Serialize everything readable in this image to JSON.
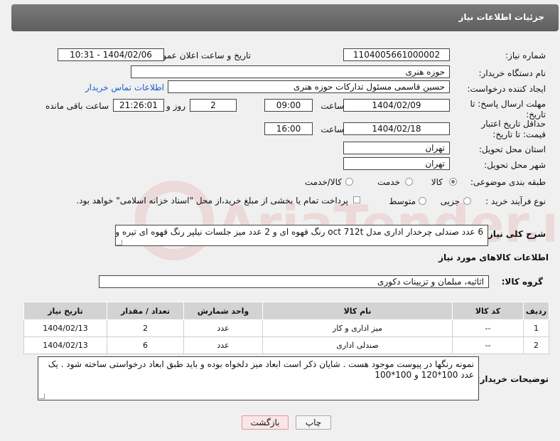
{
  "header": {
    "title": "جزئیات اطلاعات نیاز"
  },
  "form": {
    "need_number_label": "شماره نیاز:",
    "need_number": "1104005661000002",
    "announce_label": "تاریخ و ساعت اعلان عمومی:",
    "announce_value": "1404/02/06 - 10:31",
    "buyer_label": "نام دستگاه خریدار:",
    "buyer_value": "حوزه هنری",
    "creator_label": "ایجاد کننده درخواست:",
    "creator_value": "حسین قاسمی مسئول تدارکات حوزه هنری",
    "contact_link": "اطلاعات تماس خریدار",
    "deadline_label": "مهلت ارسال پاسخ: تا تاریخ:",
    "deadline_date": "1404/02/09",
    "time_label": "ساعت",
    "deadline_time": "09:00",
    "days_value": "2",
    "days_label": "روز و",
    "remaining_value": "21:26:01",
    "remaining_label": "ساعت باقی مانده",
    "price_label": "حداقل تاریخ اعتبار قیمت: تا تاریخ:",
    "price_date": "1404/02/18",
    "price_time": "16:00",
    "province_label": "استان محل تحویل:",
    "province_value": "تهران",
    "city_label": "شهر محل تحویل:",
    "city_value": "تهران",
    "category_label": "طبقه بندی موضوعی:",
    "category_options": [
      "کالا",
      "خدمت",
      "کالا/خدمت"
    ],
    "process_label": "نوع فرآیند خرید :",
    "process_options": [
      "جزیی",
      "متوسط"
    ],
    "payment_text": "پرداخت تمام یا بخشی از مبلغ خرید،از محل \"اسناد خزانه اسلامی\" خواهد بود.",
    "description_label": "شرح کلی نیاز:",
    "description_value": "6 عدد صندلی چرخدار اداری مدل oct 712t رنگ قهوه ای و 2 عدد میز جلسات نیلپر رنگ قهوه ای تیره و مشکی"
  },
  "goods": {
    "section_title": "اطلاعات کالاهای مورد نیاز",
    "group_label": "گروه کالا:",
    "group_value": "اثاثیه، مبلمان و تزیینات دکوری",
    "table": {
      "headers": [
        "ردیف",
        "کد کالا",
        "نام کالا",
        "واحد شمارش",
        "تعداد / مقدار",
        "تاریخ نیاز"
      ],
      "rows": [
        [
          "1",
          "--",
          "میز اداری و کار",
          "عدد",
          "2",
          "1404/02/13"
        ],
        [
          "2",
          "--",
          "صندلی اداری",
          "عدد",
          "6",
          "1404/02/13"
        ]
      ]
    }
  },
  "notes": {
    "label": "توضیحات خریدار:",
    "value": "نمونه رنگها در پیوست موجود هست . شایان ذکر است ابعاد میز دلخواه بوده و باید طبق ابعاد درخواستی ساخته شود . یک عدد 100*120 و 100*100"
  },
  "buttons": {
    "print": "چاپ",
    "back": "بازگشت"
  },
  "watermark": {
    "text": "AriaTender.net"
  },
  "colors": {
    "header_bg": "#6b6b6b",
    "link": "#1a5cc8",
    "back_button_bg": "#fbe6e6",
    "table_header_bg": "#d3d3d3"
  }
}
